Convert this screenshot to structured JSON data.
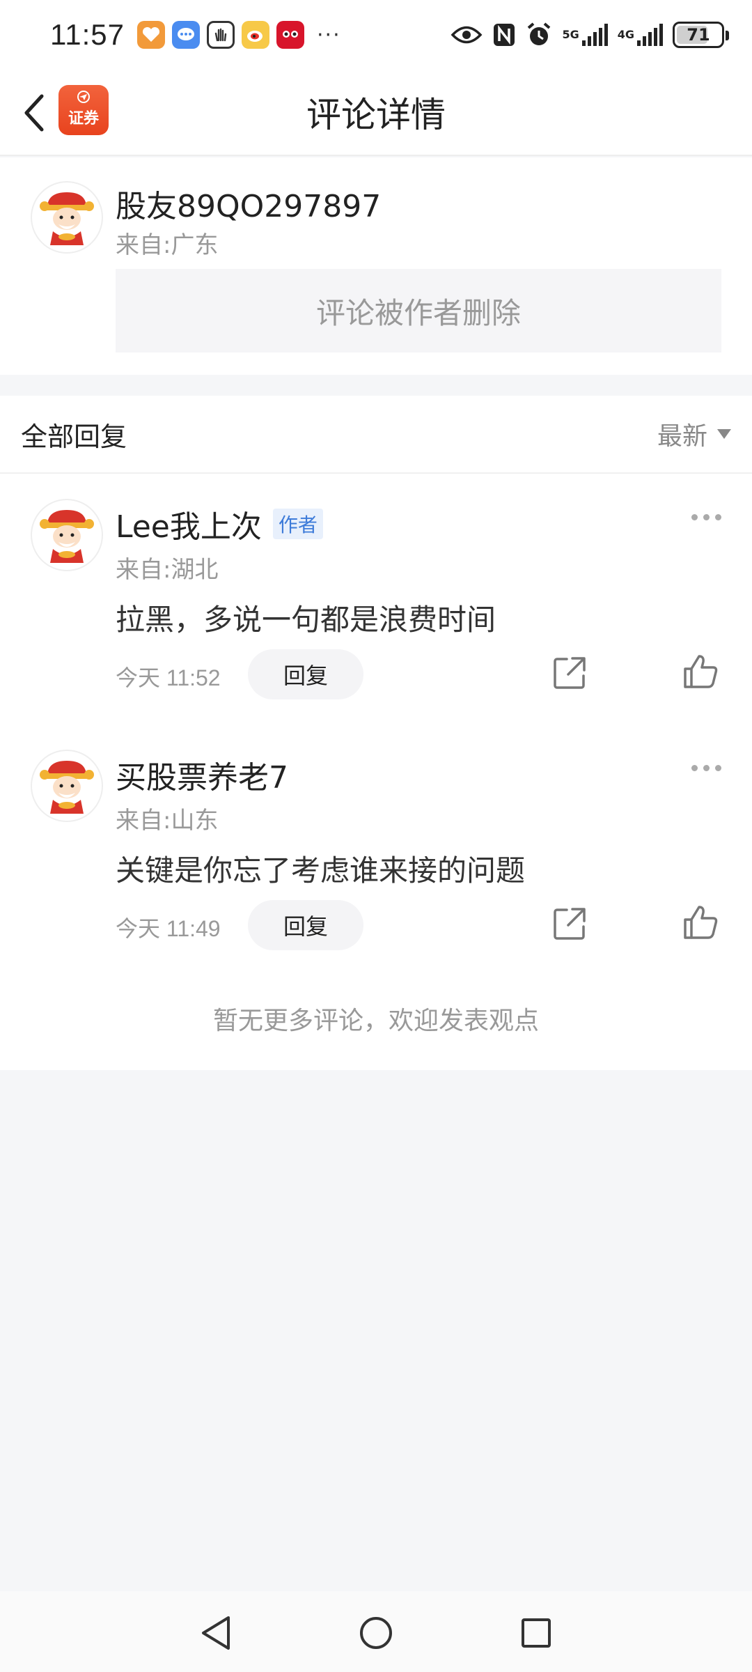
{
  "status_bar": {
    "time": "11:57",
    "network_1": "5G",
    "network_2": "4G",
    "battery": "71",
    "battery_fraction": 0.71,
    "notification_icons": [
      "health-app-icon",
      "message-app-icon",
      "gesture-app-icon",
      "weibo-app-icon",
      "tmall-app-icon"
    ],
    "more": "···"
  },
  "header": {
    "title": "评论详情",
    "logo_text": "证券"
  },
  "main_comment": {
    "username": "股友89QO297897",
    "location": "来自:广东",
    "content": "评论被作者删除"
  },
  "replies": {
    "title": "全部回复",
    "sort_label": "最新",
    "items": [
      {
        "username": "Lee我上次",
        "badge": "作者",
        "location": "来自:湖北",
        "content": "拉黑，多说一句都是浪费时间",
        "time": "今天 11:52",
        "reply_label": "回复"
      },
      {
        "username": "买股票养老7",
        "badge": "",
        "location": "来自:山东",
        "content": "关键是你忘了考虑谁来接的问题",
        "time": "今天 11:49",
        "reply_label": "回复"
      }
    ],
    "no_more": "暂无更多评论，欢迎发表观点"
  },
  "colors": {
    "accent_orange": "#e8431e",
    "badge_blue": "#3d7bd9",
    "muted_text": "#999999",
    "background": "#f5f6f8"
  }
}
